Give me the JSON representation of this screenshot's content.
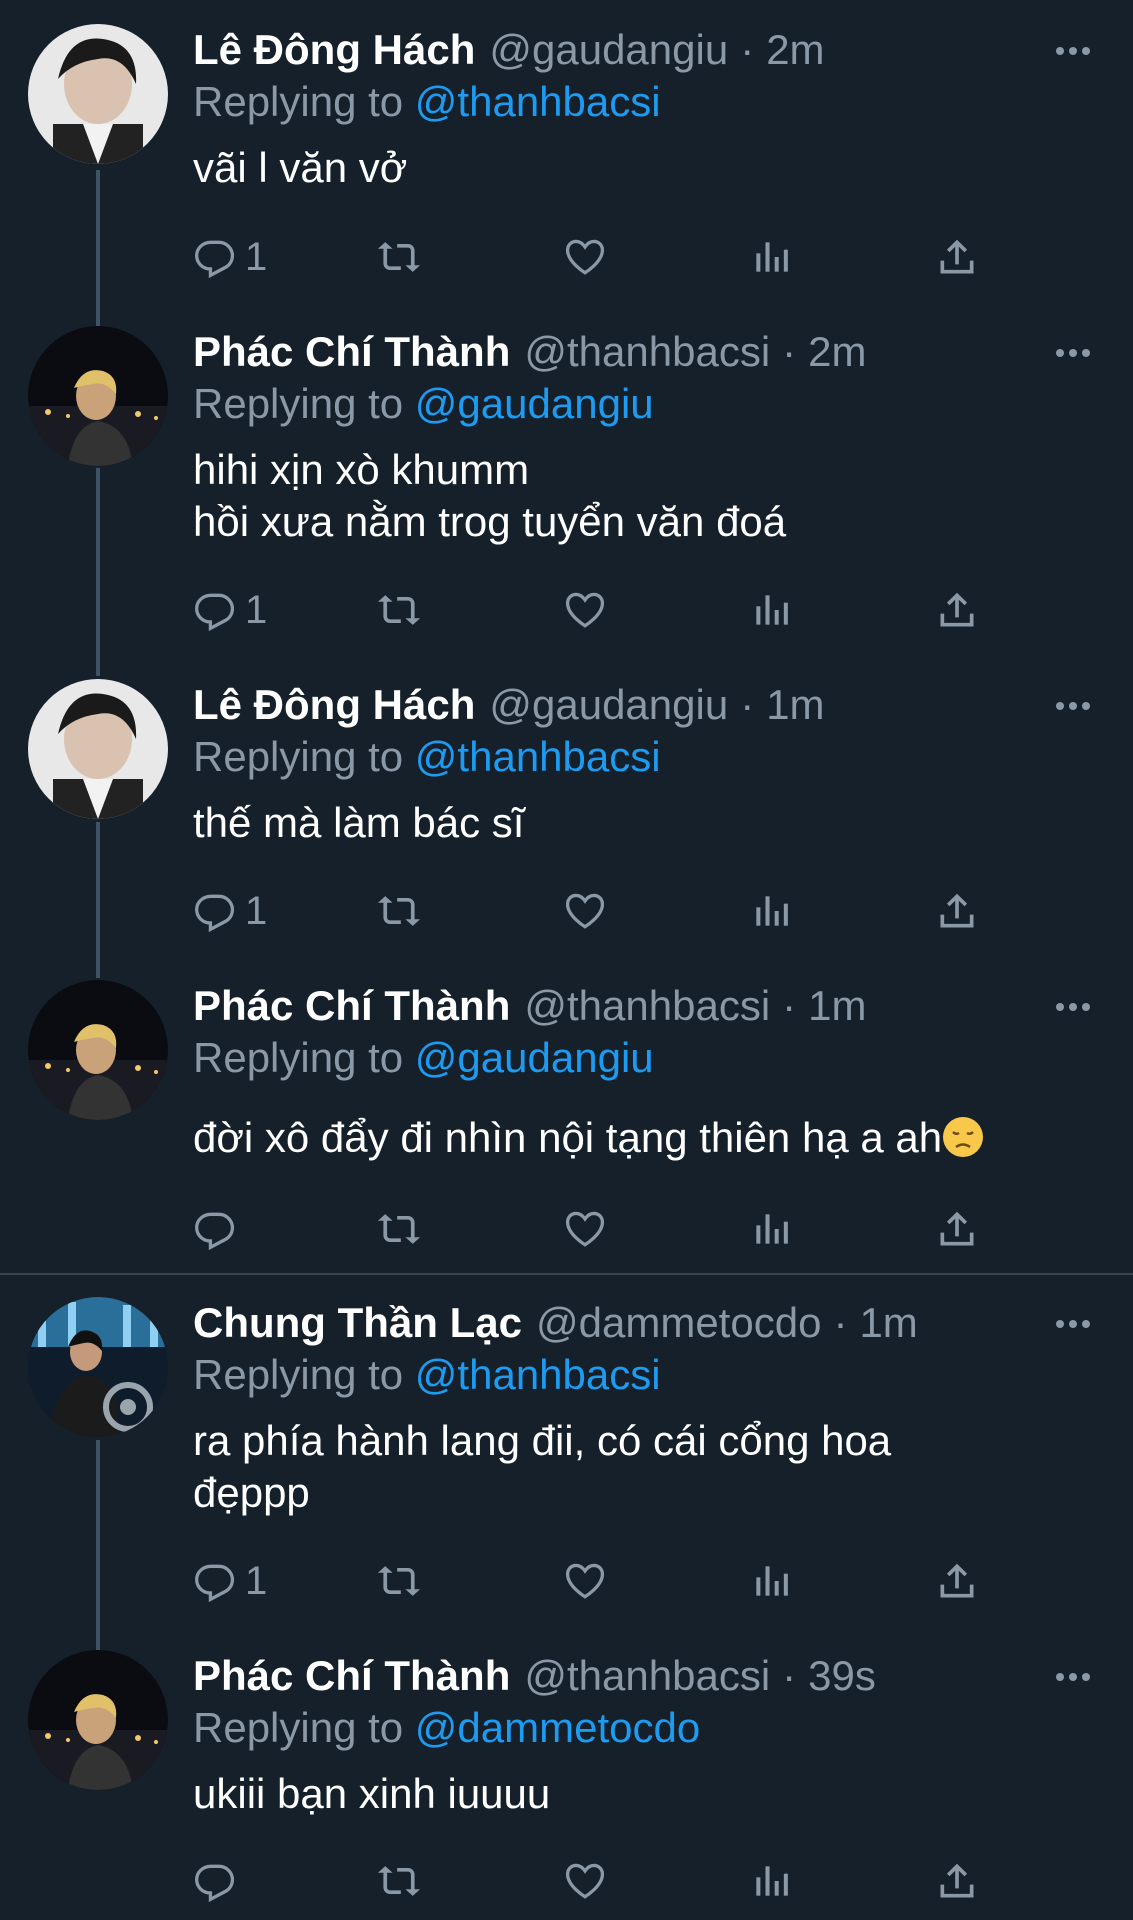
{
  "tweets": [
    {
      "name": "Lê Đông Hách",
      "handle": "@gaudangiu",
      "time": "2m",
      "replying_prefix": "Replying to ",
      "replying_to": "@thanhbacsi",
      "text": "vãi l văn vở",
      "reply_count": "1",
      "avatar": "avatar-dark-hair"
    },
    {
      "name": "Phác Chí Thành",
      "handle": "@thanhbacsi",
      "time": "2m",
      "replying_prefix": "Replying to ",
      "replying_to": "@gaudangiu",
      "text": "hihi xịn xò khumm\nhồi xưa nằm trog tuyển văn đoá",
      "reply_count": "1",
      "avatar": "avatar-night-blond"
    },
    {
      "name": "Lê Đông Hách",
      "handle": "@gaudangiu",
      "time": "1m",
      "replying_prefix": "Replying to ",
      "replying_to": "@thanhbacsi",
      "text": "thế mà làm bác sĩ",
      "reply_count": "1",
      "avatar": "avatar-dark-hair"
    },
    {
      "name": "Phác Chí Thành",
      "handle": "@thanhbacsi",
      "time": "1m",
      "replying_prefix": "Replying to ",
      "replying_to": "@gaudangiu",
      "text": "đời xô đẩy đi nhìn nội tạng thiên hạ a ah",
      "reply_count": "",
      "avatar": "avatar-night-blond"
    },
    {
      "name": "Chung Thần Lạc",
      "handle": "@dammetocdo",
      "time": "1m",
      "replying_prefix": "Replying to ",
      "replying_to": "@thanhbacsi",
      "text": "ra phía hành lang đii, có cái cổng hoa\nđẹppp",
      "reply_count": "1",
      "avatar": "avatar-motorbike"
    },
    {
      "name": "Phác Chí Thành",
      "handle": "@thanhbacsi",
      "time": "39s",
      "replying_prefix": "Replying to ",
      "replying_to": "@dammetocdo",
      "text": "ukiii bạn xinh iuuuu",
      "reply_count": "",
      "avatar": "avatar-night-blond"
    }
  ],
  "icons": {
    "reply": "reply-icon",
    "retweet": "retweet-icon",
    "like": "heart-icon",
    "views": "views-icon",
    "share": "share-icon",
    "more": "more-icon"
  },
  "colors": {
    "background": "#15202b",
    "muted": "#8b98a5",
    "link": "#1d9bf0",
    "thread_line": "#3d5466"
  }
}
